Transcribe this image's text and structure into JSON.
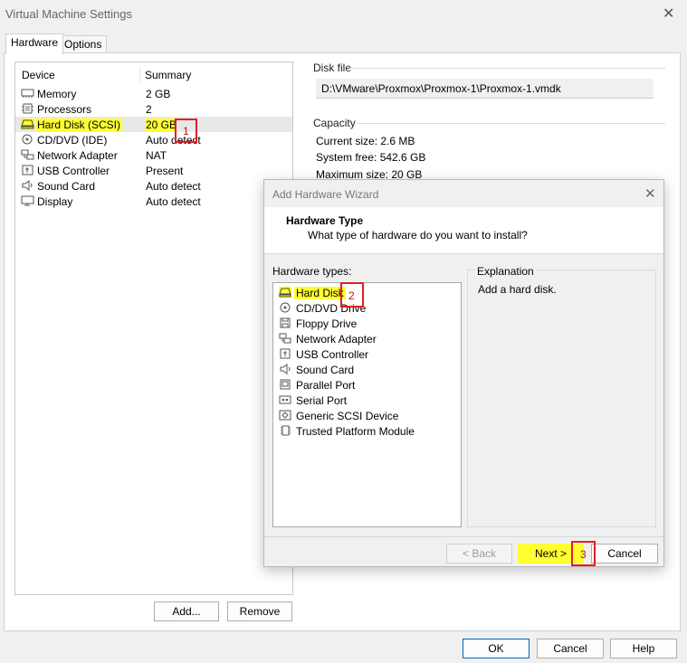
{
  "window": {
    "title": "Virtual Machine Settings"
  },
  "tabs": [
    {
      "label": "Hardware"
    },
    {
      "label": "Options"
    }
  ],
  "device_list": {
    "headers": {
      "device": "Device",
      "summary": "Summary"
    },
    "rows": [
      {
        "icon": "memory-icon",
        "name": "Memory",
        "summary": "2 GB"
      },
      {
        "icon": "processor-icon",
        "name": "Processors",
        "summary": "2"
      },
      {
        "icon": "hard-disk-icon",
        "name": "Hard Disk (SCSI)",
        "summary": "20 GB"
      },
      {
        "icon": "cd-dvd-icon",
        "name": "CD/DVD (IDE)",
        "summary": "Auto detect"
      },
      {
        "icon": "network-adapter-icon",
        "name": "Network Adapter",
        "summary": "NAT"
      },
      {
        "icon": "usb-icon",
        "name": "USB Controller",
        "summary": "Present"
      },
      {
        "icon": "sound-card-icon",
        "name": "Sound Card",
        "summary": "Auto detect"
      },
      {
        "icon": "display-icon",
        "name": "Display",
        "summary": "Auto detect"
      }
    ]
  },
  "buttons": {
    "add": "Add...",
    "remove": "Remove",
    "ok": "OK",
    "cancel": "Cancel",
    "help": "Help"
  },
  "disk_file": {
    "label": "Disk file",
    "path": "D:\\VMware\\Proxmox\\Proxmox-1\\Proxmox-1.vmdk"
  },
  "capacity": {
    "label": "Capacity",
    "current": "Current size: 2.6 MB",
    "free": "System free: 542.6 GB",
    "max": "Maximum size: 20 GB"
  },
  "wizard": {
    "title": "Add Hardware Wizard",
    "heading": "Hardware Type",
    "subheading": "What type of hardware do you want to install?",
    "types_label": "Hardware types:",
    "explanation_label": "Explanation",
    "explanation_text": "Add a hard disk.",
    "types": [
      {
        "icon": "hard-disk-icon",
        "name": "Hard Disk"
      },
      {
        "icon": "cd-dvd-icon",
        "name": "CD/DVD Drive"
      },
      {
        "icon": "floppy-icon",
        "name": "Floppy Drive"
      },
      {
        "icon": "network-adapter-icon",
        "name": "Network Adapter"
      },
      {
        "icon": "usb-icon",
        "name": "USB Controller"
      },
      {
        "icon": "sound-card-icon",
        "name": "Sound Card"
      },
      {
        "icon": "parallel-port-icon",
        "name": "Parallel Port"
      },
      {
        "icon": "serial-port-icon",
        "name": "Serial Port"
      },
      {
        "icon": "scsi-device-icon",
        "name": "Generic SCSI Device"
      },
      {
        "icon": "tpm-icon",
        "name": "Trusted Platform Module"
      }
    ],
    "buttons": {
      "back": "< Back",
      "next": "Next >",
      "cancel": "Cancel"
    }
  },
  "annotations": {
    "step1": "1",
    "step2": "2",
    "step3": "3"
  },
  "colors": {
    "highlight": "#ffff33",
    "annotation_red": "#e02020",
    "ok_border": "#0067c0"
  }
}
